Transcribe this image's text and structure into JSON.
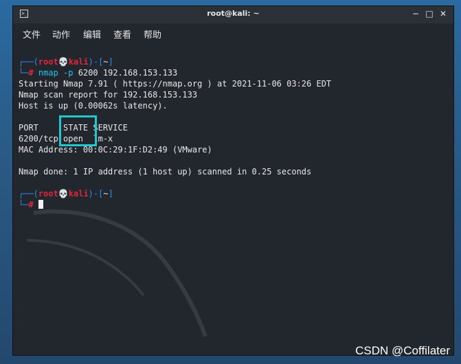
{
  "window": {
    "title": "root@kali: ~",
    "title_icon": "terminal-icon",
    "controls": {
      "minimize": "−",
      "maximize": "□",
      "close": "✕"
    }
  },
  "menu": [
    "文件",
    "动作",
    "编辑",
    "查看",
    "帮助"
  ],
  "prompt1": {
    "open": "┌──(",
    "user": "root",
    "skull": "💀",
    "host": "kali",
    "mid": ")-[",
    "dir": "~",
    "close": "]",
    "line2_prefix": "└─",
    "hash": "#"
  },
  "command": {
    "name": "nmap",
    "flag": "-p",
    "args": "6200 192.168.153.133"
  },
  "output": [
    "Starting Nmap 7.91 ( https://nmap.org ) at 2021-11-06 03:26 EDT",
    "Nmap scan report for 192.168.153.133",
    "Host is up (0.00062s latency).",
    "",
    "PORT     STATE SERVICE",
    "6200/tcp open  lm-x",
    "MAC Address: 00:0C:29:1F:D2:49 (VMware)",
    "",
    "Nmap done: 1 IP address (1 host up) scanned in 0.25 seconds"
  ],
  "prompt2": {
    "open": "┌──(",
    "user": "root",
    "skull": "💀",
    "host": "kali",
    "mid": ")-[",
    "dir": "~",
    "close": "]",
    "line2_prefix": "└─",
    "hash": "#"
  },
  "watermark": "CSDN @Coffilater",
  "colors": {
    "prompt_blue": "#2f8cf5",
    "prompt_red": "#e0253a",
    "highlight": "#24c6d0",
    "terminal_bg": "#22272e"
  }
}
